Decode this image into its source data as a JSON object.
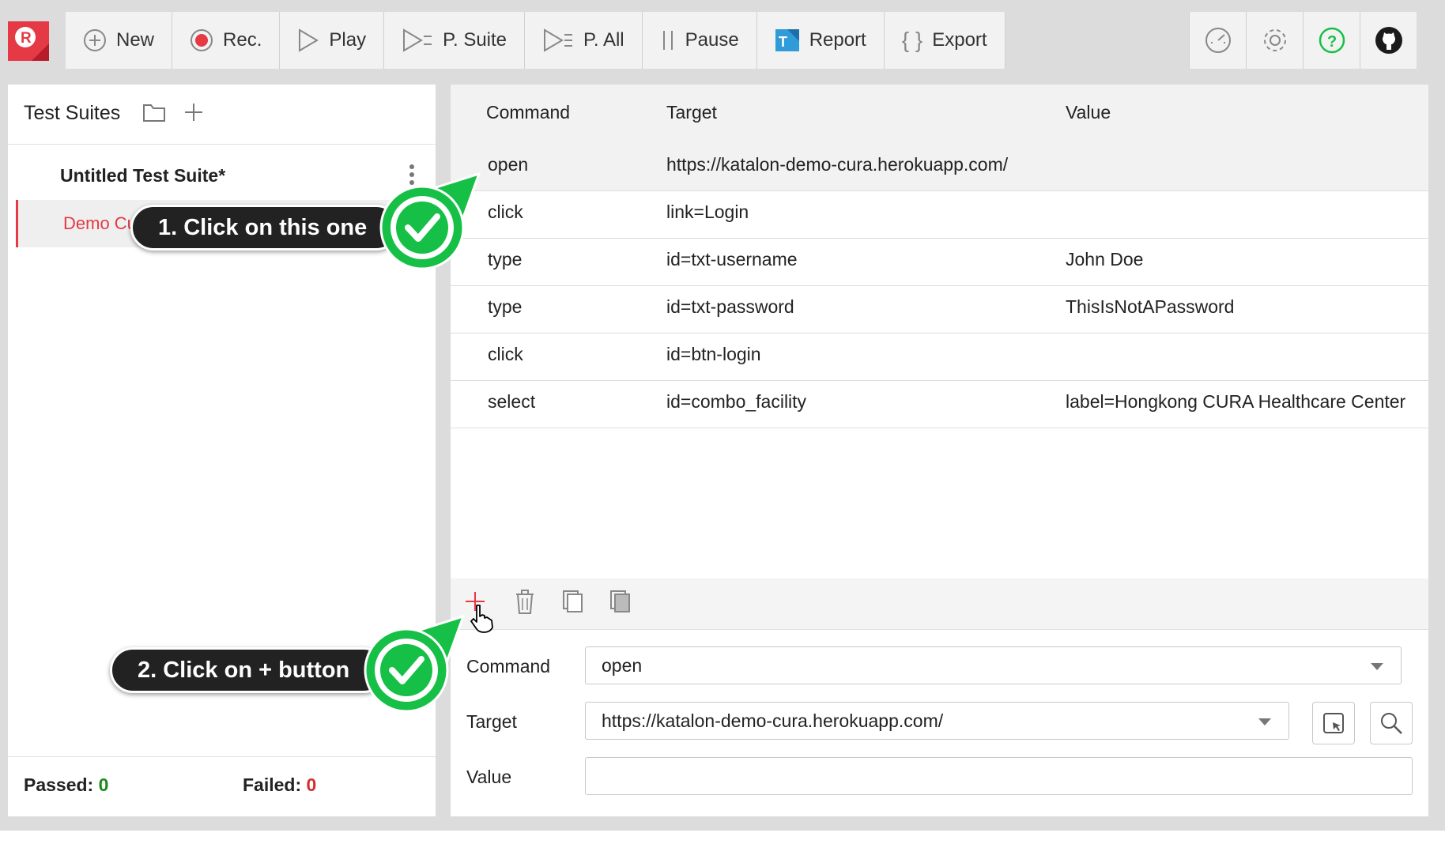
{
  "toolbar": {
    "buttons": [
      {
        "label": "New",
        "icon": "plus-circle-icon"
      },
      {
        "label": "Rec.",
        "icon": "record-icon"
      },
      {
        "label": "Play",
        "icon": "play-icon"
      },
      {
        "label": "P. Suite",
        "icon": "play-suite-icon"
      },
      {
        "label": "P. All",
        "icon": "play-all-icon"
      },
      {
        "label": "Pause",
        "icon": "pause-icon"
      },
      {
        "label": "Report",
        "icon": "katalon-report-icon"
      },
      {
        "label": "Export",
        "icon": "braces-icon"
      }
    ],
    "right_icons": [
      "speedometer-icon",
      "gear-icon",
      "help-icon",
      "github-icon"
    ]
  },
  "left_panel": {
    "title": "Test Suites",
    "suite_name": "Untitled Test Suite*",
    "test_case": "Demo Cura App",
    "passed_label": "Passed:",
    "passed_value": "0",
    "failed_label": "Failed:",
    "failed_value": "0"
  },
  "table": {
    "headers": [
      "Command",
      "Target",
      "Value"
    ],
    "rows": [
      {
        "command": "open",
        "target": "https://katalon-demo-cura.herokuapp.com/",
        "value": ""
      },
      {
        "command": "click",
        "target": "link=Login",
        "value": ""
      },
      {
        "command": "type",
        "target": "id=txt-username",
        "value": "John Doe"
      },
      {
        "command": "type",
        "target": "id=txt-password",
        "value": "ThisIsNotAPassword"
      },
      {
        "command": "click",
        "target": "id=btn-login",
        "value": ""
      },
      {
        "command": "select",
        "target": "id=combo_facility",
        "value": "label=Hongkong CURA Healthcare Center"
      }
    ]
  },
  "editor": {
    "command_label": "Command",
    "command_value": "open",
    "target_label": "Target",
    "target_value": "https://katalon-demo-cura.herokuapp.com/",
    "value_label": "Value",
    "value_value": ""
  },
  "callouts": {
    "step1": "1. Click on this one",
    "step2": "2. Click on + button"
  },
  "colors": {
    "accent_red": "#e53945",
    "callout_green": "#16c046",
    "passed_green": "#1b8a1b",
    "failed_red": "#d32f2f"
  }
}
